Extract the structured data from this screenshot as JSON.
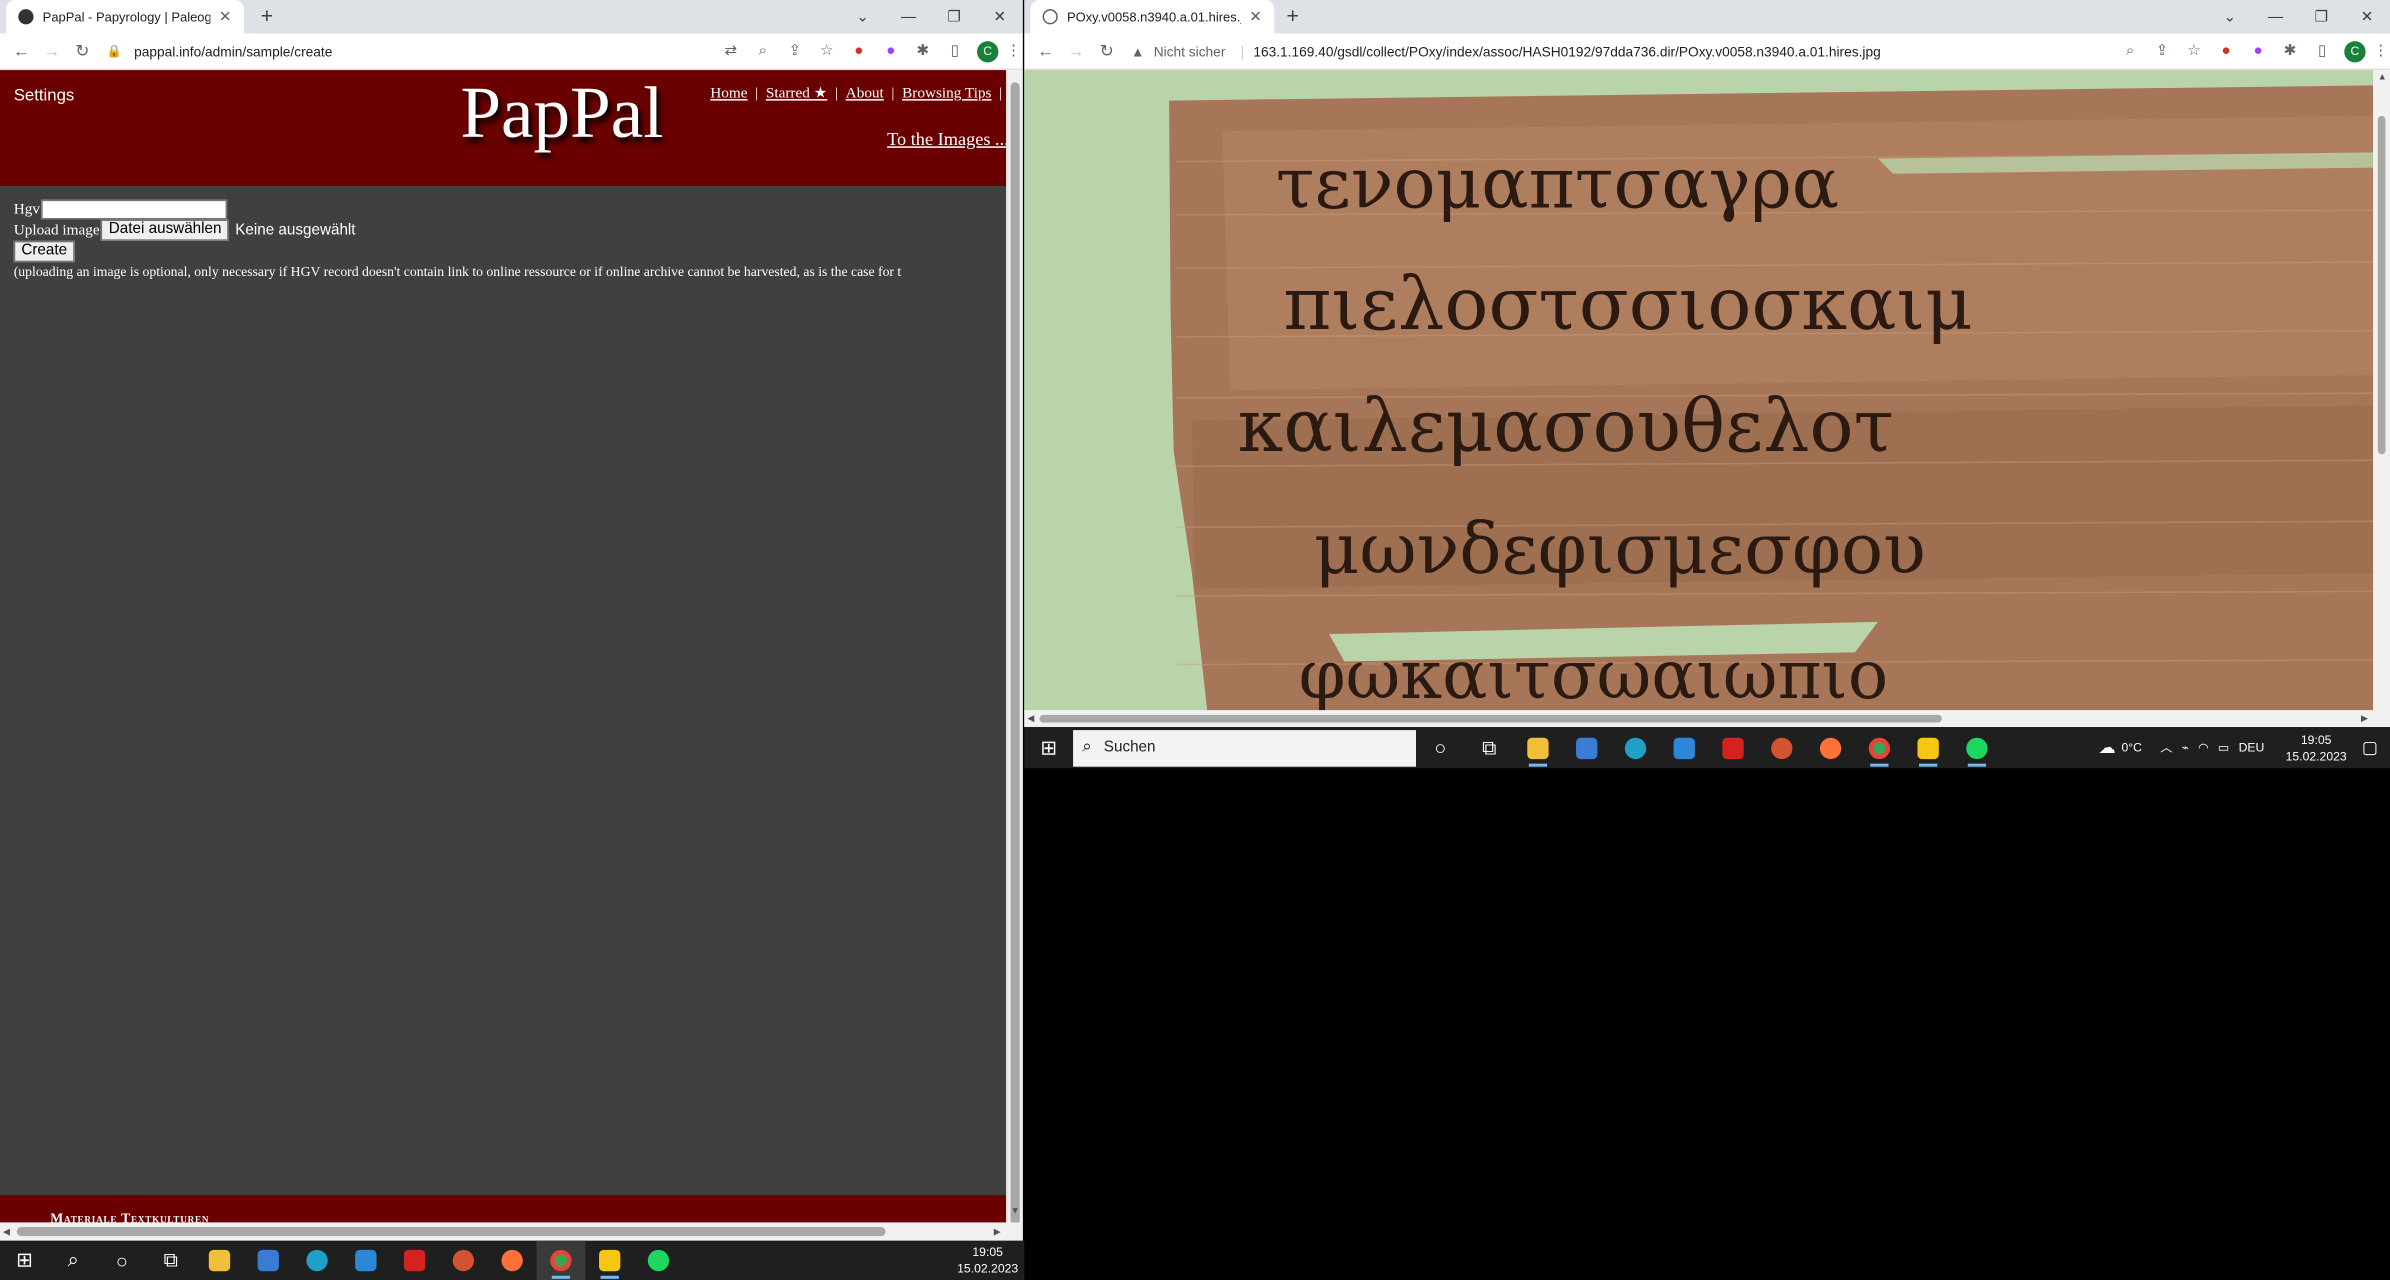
{
  "left_window": {
    "tab_title": "PapPal - Papyrology | Paleograph",
    "url": "pappal.info/admin/sample/create",
    "avatar_letter": "C"
  },
  "right_window": {
    "tab_title": "POxy.v0058.n3940.a.01.hires.jpg",
    "security_label": "Nicht sicher",
    "url": "163.1.169.40/gsdl/collect/POxy/index/assoc/HASH0192/97dda736.dir/POxy.v0058.n3940.a.01.hires.jpg",
    "avatar_letter": "C"
  },
  "pappal": {
    "settings": "Settings",
    "logo": "PapPal",
    "nav": [
      "Home",
      "Starred ★",
      "About",
      "Browsing Tips"
    ],
    "to_images": "To the Images ...",
    "form": {
      "hgv_label": "Hgv",
      "hgv_value": "",
      "upload_label": "Upload image",
      "file_button": "Datei auswählen",
      "file_status": "Keine ausgewählt",
      "create_button": "Create",
      "hint": "(uploading an image is optional, only necessary if HGV record doesn't contain link to online ressource or if online archive cannot be harvested, as is the case for t"
    },
    "footer": "Materiale Textkulturen"
  },
  "taskbar_small": {
    "search_label": "Suchen",
    "weather": "0°C",
    "language": "DEU",
    "time": "19:05",
    "date": "15.02.2023"
  },
  "taskbar_main": {
    "time": "19:05",
    "date": "15.02.2023"
  }
}
